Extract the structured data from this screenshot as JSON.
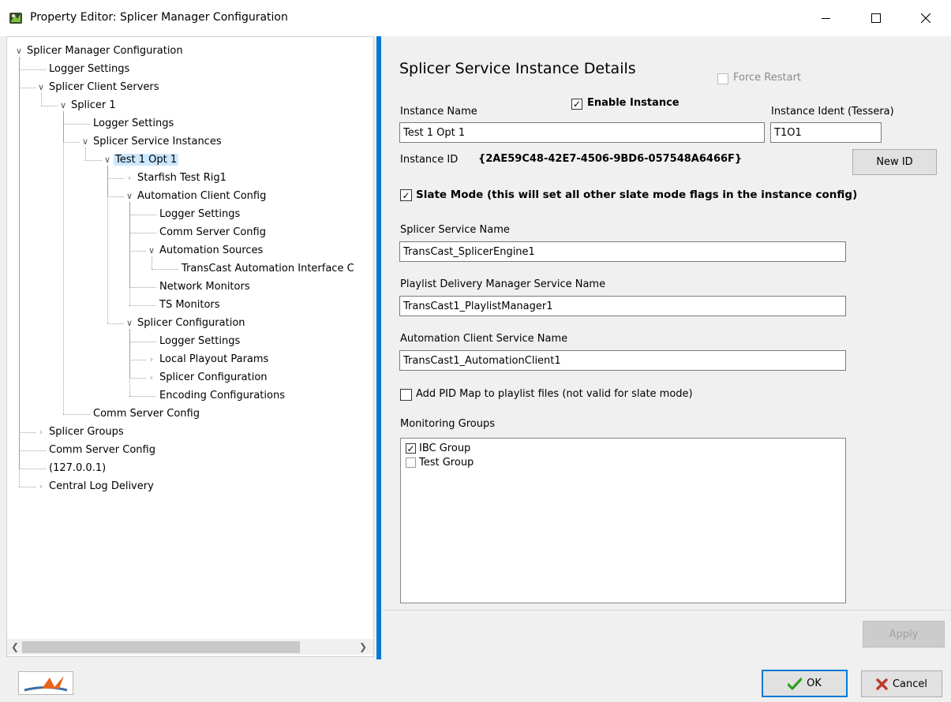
{
  "window": {
    "title": "Property Editor: Splicer Manager Configuration"
  },
  "tree": {
    "nodes": [
      {
        "label": "Splicer Manager Configuration",
        "state": "expanded"
      },
      {
        "label": "Logger Settings",
        "state": "leaf"
      },
      {
        "label": "Splicer Client Servers",
        "state": "expanded"
      },
      {
        "label": "Splicer 1",
        "state": "expanded"
      },
      {
        "label": "Logger Settings",
        "state": "leaf"
      },
      {
        "label": "Splicer Service Instances",
        "state": "expanded"
      },
      {
        "label": "Test 1 Opt 1",
        "state": "expanded",
        "selected": true
      },
      {
        "label": "Starfish Test Rig1",
        "state": "collapsed"
      },
      {
        "label": "Automation Client Config",
        "state": "expanded"
      },
      {
        "label": "Logger Settings",
        "state": "leaf"
      },
      {
        "label": "Comm Server Config",
        "state": "leaf"
      },
      {
        "label": "Automation Sources",
        "state": "expanded"
      },
      {
        "label": "TransCast Automation Interface C",
        "state": "leaf"
      },
      {
        "label": "Network Monitors",
        "state": "leaf"
      },
      {
        "label": "TS Monitors",
        "state": "leaf"
      },
      {
        "label": "Splicer Configuration",
        "state": "expanded"
      },
      {
        "label": "Logger Settings",
        "state": "leaf"
      },
      {
        "label": "Local Playout Params",
        "state": "collapsed"
      },
      {
        "label": "Splicer Configuration",
        "state": "collapsed"
      },
      {
        "label": "Encoding Configurations",
        "state": "leaf"
      },
      {
        "label": "Comm Server Config",
        "state": "leaf"
      },
      {
        "label": "Splicer Groups",
        "state": "collapsed"
      },
      {
        "label": "Comm Server Config",
        "state": "leaf"
      },
      {
        "label": "(127.0.0.1)",
        "state": "leaf"
      },
      {
        "label": "Central Log Delivery",
        "state": "collapsed"
      }
    ]
  },
  "details": {
    "title": "Splicer Service Instance Details",
    "force_restart_label": "Force Restart",
    "force_restart_checked": false,
    "enable_instance_label": "Enable Instance",
    "enable_instance_checked": true,
    "instance_name_label": "Instance Name",
    "instance_name_value": "Test 1 Opt 1",
    "instance_ident_label": "Instance Ident (Tessera)",
    "instance_ident_value": "T1O1",
    "instance_id_label": "Instance ID",
    "instance_id_value": "{2AE59C48-42E7-4506-9BD6-057548A6466F}",
    "new_id_label": "New ID",
    "slate_mode_label": "Slate Mode (this will set all other slate mode flags in the instance config)",
    "slate_mode_checked": true,
    "splicer_service_name_label": "Splicer Service Name",
    "splicer_service_name_value": "TransCast_SplicerEngine1",
    "playlist_delivery_label": "Playlist Delivery Manager Service Name",
    "playlist_delivery_value": "TransCast1_PlaylistManager1",
    "automation_client_label": "Automation Client Service Name",
    "automation_client_value": "TransCast1_AutomationClient1",
    "pid_map_label": "Add PID Map to playlist files (not valid for slate mode)",
    "pid_map_checked": false,
    "monitoring_groups_label": "Monitoring Groups",
    "monitoring_groups": [
      {
        "label": "IBC Group",
        "checked": true
      },
      {
        "label": "Test Group",
        "checked": false
      }
    ],
    "apply_label": "Apply"
  },
  "footer": {
    "ok_label": "OK",
    "cancel_label": "Cancel"
  },
  "colors": {
    "accent": "#0078d7",
    "selection": "#cce8ff",
    "ok_check": "#2f9e1f",
    "cancel_x": "#c0392b"
  }
}
